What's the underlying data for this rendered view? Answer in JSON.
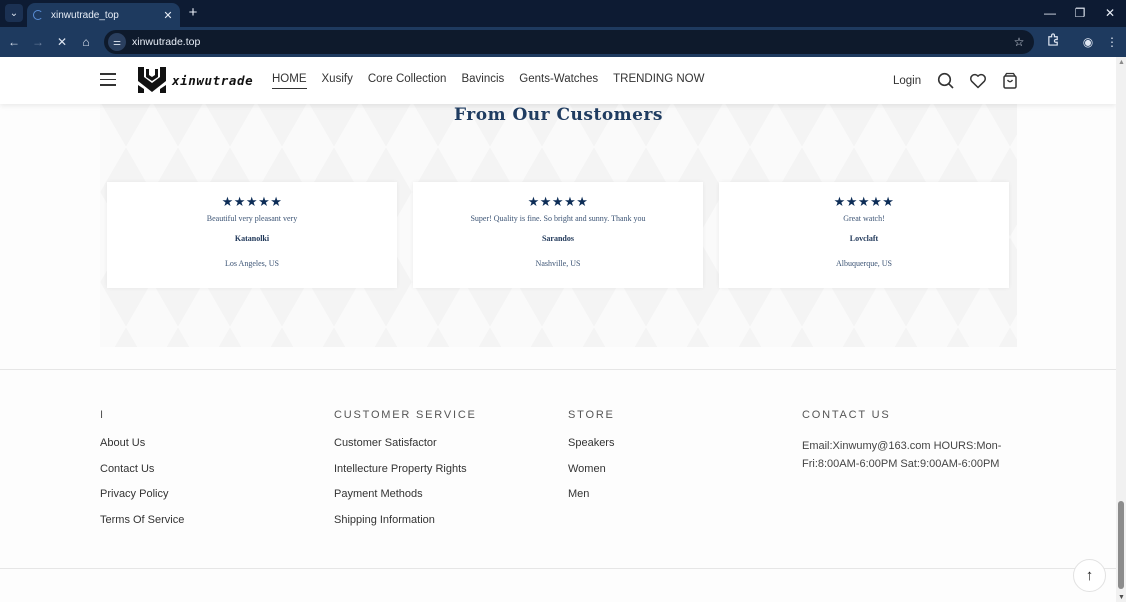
{
  "browser": {
    "tab_title": "xinwutrade_top",
    "url": "xinwutrade.top",
    "icons": {
      "tab_menu": "chevron-down-icon",
      "loading": "spinner-icon",
      "tab_close": "close-icon",
      "new_tab": "plus-icon",
      "minimize": "minimize-icon",
      "restore": "restore-icon",
      "close_window": "close-icon",
      "back": "arrow-left-icon",
      "forward": "arrow-right-icon",
      "stop": "close-icon",
      "home": "home-icon",
      "site_info": "tune-icon",
      "bookmark": "star-icon",
      "extensions": "puzzle-icon",
      "profile": "account-icon",
      "menu": "kebab-icon"
    },
    "glyphs": {
      "tab_menu": "⌄",
      "tab_close": "✕",
      "new_tab": "+",
      "minimize": "—",
      "restore": "❐",
      "close_window": "✕",
      "back": "←",
      "forward": "→",
      "stop": "✕",
      "home": "⌂",
      "site_info": "⚌",
      "bookmark": "☆",
      "profile": "◉",
      "menu": "⋮",
      "scroll_up": "▲",
      "scroll_down": "▼",
      "back_to_top": "↑",
      "star": "★"
    }
  },
  "header": {
    "logo_text": "xinwutrade",
    "nav": [
      {
        "label": "HOME",
        "active": true
      },
      {
        "label": "Xusify",
        "active": false
      },
      {
        "label": "Core Collection",
        "active": false
      },
      {
        "label": "Bavincis",
        "active": false
      },
      {
        "label": "Gents-Watches",
        "active": false
      },
      {
        "label": "TRENDING NOW",
        "active": false
      }
    ],
    "login_label": "Login"
  },
  "testimonials": {
    "title": "From Our Customers",
    "star_color": "#0d2d57",
    "reviews": [
      {
        "stars": 5,
        "stars_text": "★★★★★",
        "text": "Beautiful very pleasant very",
        "name": "Katanolki",
        "location": "Los Angeles, US"
      },
      {
        "stars": 5,
        "stars_text": "★★★★★",
        "text": "Super! Quality is fine. So bright and sunny. Thank you",
        "name": "Sarandos",
        "location": "Nashville, US"
      },
      {
        "stars": 5,
        "stars_text": "★★★★★",
        "text": "Great watch!",
        "name": "Lovclaft",
        "location": "Albuquerque, US"
      }
    ]
  },
  "footer": {
    "columns": [
      {
        "heading": "I",
        "links": [
          "About Us",
          "Contact Us",
          "Privacy Policy",
          "Terms Of Service"
        ]
      },
      {
        "heading": "CUSTOMER SERVICE",
        "links": [
          "Customer Satisfactor",
          "Intellecture Property Rights",
          "Payment Methods",
          "Shipping Information"
        ]
      },
      {
        "heading": "STORE",
        "links": [
          "Speakers",
          "Women",
          "Men"
        ]
      }
    ],
    "contact": {
      "heading": "CONTACT US",
      "text": "Email:Xinwumy@163.com HOURS:Mon-Fri:8:00AM-6:00PM Sat:9:00AM-6:00PM"
    }
  }
}
